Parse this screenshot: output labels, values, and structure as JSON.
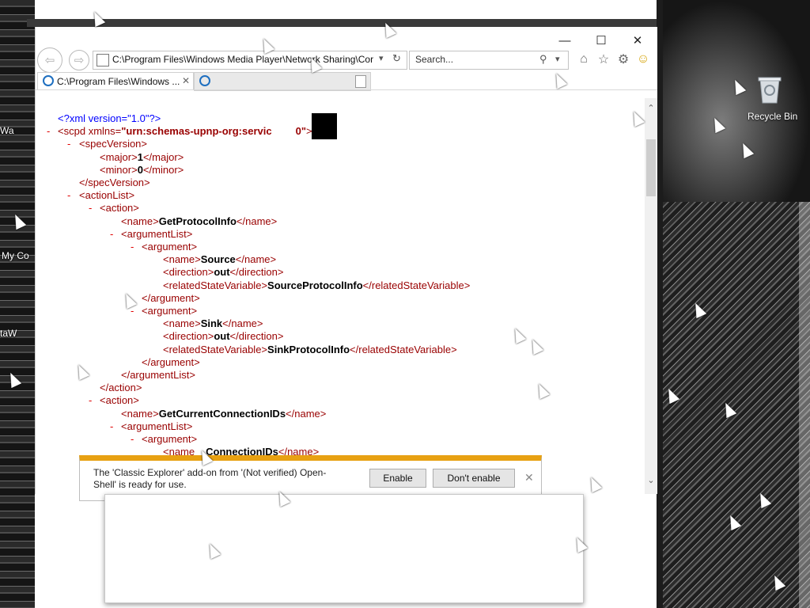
{
  "desktop": {
    "recycle_bin_label": "Recycle Bin",
    "left_fragments": [
      "Wa",
      "My Co",
      "taW"
    ]
  },
  "browser": {
    "caption": {
      "minimize": "—",
      "maximize": "☐",
      "close": "✕"
    },
    "address": "C:\\Program Files\\Windows Media Player\\Network Sharing\\Cor",
    "search_placeholder": "Search...",
    "tabs": [
      {
        "label": "C:\\Program Files\\Windows ...",
        "active": true
      },
      {
        "label": "",
        "active": false
      }
    ],
    "icons": [
      "back-icon",
      "forward-icon",
      "refresh-icon",
      "dropdown-icon",
      "search-icon",
      "home-icon",
      "favorites-icon",
      "tools-gear-icon",
      "smiley-feedback-icon"
    ]
  },
  "xml": {
    "declaration": "<?xml version=\"1.0\"?>",
    "scpd_open": "<scpd",
    "scpd_attr": "xmlns=",
    "scpd_ns": "\"urn:schemas-upnp-org:servic",
    "scpd_ns_end": "0\"",
    "spec_open": "<specVersion>",
    "major_open": "<major>",
    "major_val": "1",
    "major_close": "</major>",
    "minor_open": "<minor>",
    "minor_val": "0",
    "minor_close": "</minor>",
    "spec_close": "</specVersion>",
    "actionlist_open": "<actionList>",
    "action_open": "<action>",
    "name_open": "<name>",
    "name_close": "</name>",
    "action1_name": "GetProtocolInfo",
    "arglist_open": "<argumentList>",
    "arg_open": "<argument>",
    "arg_close": "</argument>",
    "direction_open": "<direction>",
    "direction_close": "</direction>",
    "rsv_open": "<relatedStateVariable>",
    "rsv_close": "</relatedStateVariable>",
    "arg1_name": "Source",
    "arg1_dir": "out",
    "arg1_rsv": "SourceProtocolInfo",
    "arg2_name": "Sink",
    "arg2_dir": "out",
    "arg2_rsv": "SinkProtocolInfo",
    "arglist_close": "</argumentList>",
    "action_close": "</action>",
    "action2_name": "GetCurrentConnectionIDs",
    "arg3_name_partial": "ConnectionIDs",
    "arg3_name_partial_prefix": "<name"
  },
  "notification": {
    "text": "The 'Classic Explorer' add-on from '(Not verified) Open-Shell' is ready for use.",
    "enable_label": "Enable",
    "dont_enable_label": "Don't enable",
    "close": "✕",
    "accent_color": "#e8a112"
  }
}
